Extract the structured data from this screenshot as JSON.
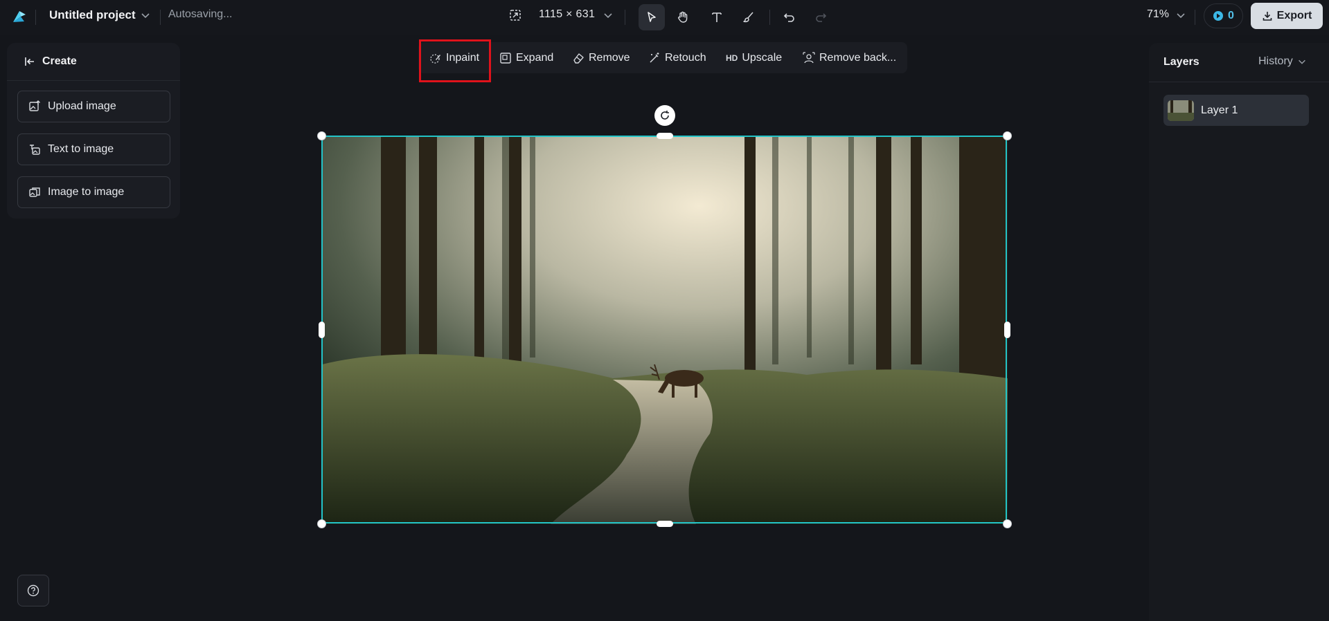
{
  "header": {
    "project_name": "Untitled project",
    "save_status": "Autosaving...",
    "canvas_size": "1115 × 631",
    "zoom": "71%",
    "credits": "0",
    "export_label": "Export"
  },
  "tools": [
    "select",
    "hand",
    "text",
    "brush",
    "undo",
    "redo"
  ],
  "left_panel": {
    "title": "Create",
    "buttons": [
      "Upload image",
      "Text to image",
      "Image to image"
    ]
  },
  "edit_toolbar": {
    "items": [
      "Inpaint",
      "Expand",
      "Remove",
      "Retouch",
      "Upscale",
      "Remove back..."
    ],
    "upscale_badge": "HD",
    "highlighted": "Inpaint"
  },
  "right_panel": {
    "tab_layers": "Layers",
    "tab_history": "History",
    "layers": [
      "Layer 1"
    ]
  },
  "colors": {
    "accent_selection": "#22c4c8",
    "highlight_box": "#e0121b",
    "background": "#14161b"
  }
}
